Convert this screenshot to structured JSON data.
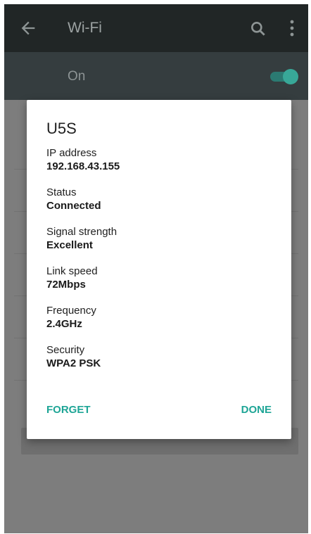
{
  "toolbar": {
    "title": "Wi-Fi",
    "back_icon": "arrow-left-icon",
    "search_icon": "search-icon",
    "more_icon": "more-vert-icon"
  },
  "switchbar": {
    "label": "On",
    "enabled": true
  },
  "dialog": {
    "title": "U5S",
    "fields": [
      {
        "label": "IP address",
        "value": "192.168.43.155"
      },
      {
        "label": "Status",
        "value": "Connected"
      },
      {
        "label": "Signal strength",
        "value": "Excellent"
      },
      {
        "label": "Link speed",
        "value": "72Mbps"
      },
      {
        "label": "Frequency",
        "value": "2.4GHz"
      },
      {
        "label": "Security",
        "value": "WPA2 PSK"
      }
    ],
    "forget_label": "FORGET",
    "done_label": "DONE"
  },
  "colors": {
    "accent": "#1ea596",
    "toolbar": "#212626",
    "switchbar": "#353d3f",
    "scrim": "#7d7d7d"
  }
}
